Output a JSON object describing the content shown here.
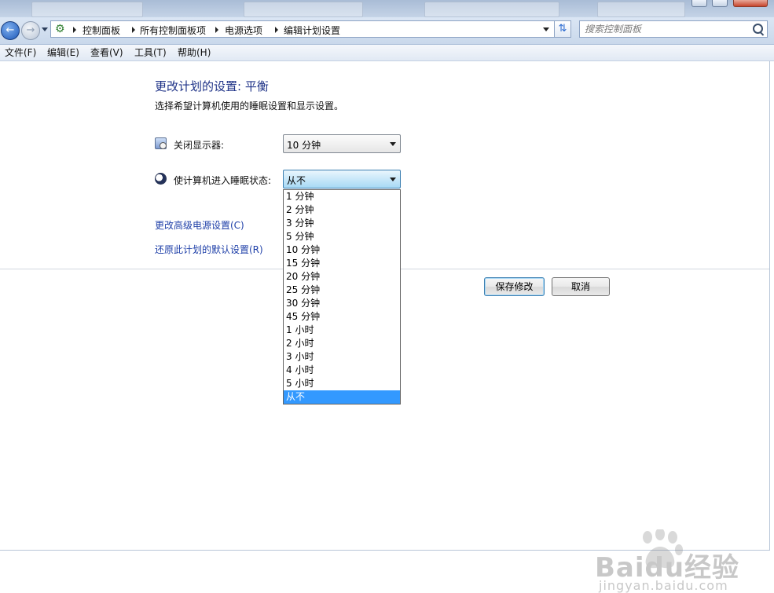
{
  "address_bar": {
    "breadcrumbs": [
      "控制面板",
      "所有控制面板项",
      "电源选项",
      "编辑计划设置"
    ],
    "search_placeholder": "搜索控制面板"
  },
  "menu": {
    "items": [
      "文件(F)",
      "编辑(E)",
      "查看(V)",
      "工具(T)",
      "帮助(H)"
    ]
  },
  "page": {
    "title": "更改计划的设置: 平衡",
    "subtitle": "选择希望计算机使用的睡眠设置和显示设置。"
  },
  "settings": {
    "display": {
      "label": "关闭显示器:",
      "value": "10 分钟",
      "icon": "monitor-power-icon"
    },
    "sleep": {
      "label": "使计算机进入睡眠状态:",
      "value": "从不",
      "icon": "moon-sleep-icon"
    }
  },
  "sleep_options": [
    "1 分钟",
    "2 分钟",
    "3 分钟",
    "5 分钟",
    "10 分钟",
    "15 分钟",
    "20 分钟",
    "25 分钟",
    "30 分钟",
    "45 分钟",
    "1 小时",
    "2 小时",
    "3 小时",
    "4 小时",
    "5 小时",
    "从不"
  ],
  "sleep_selected_index": 15,
  "links": {
    "advanced": "更改高级电源设置(C)",
    "restore": "还原此计划的默认设置(R)"
  },
  "buttons": {
    "save": "保存修改",
    "cancel": "取消"
  },
  "watermark": {
    "text": "Baidu经验",
    "url": "jingyan.baidu.com"
  },
  "colors": {
    "title": "#1e3287",
    "link": "#1e3fa8",
    "selection": "#3399ff"
  }
}
